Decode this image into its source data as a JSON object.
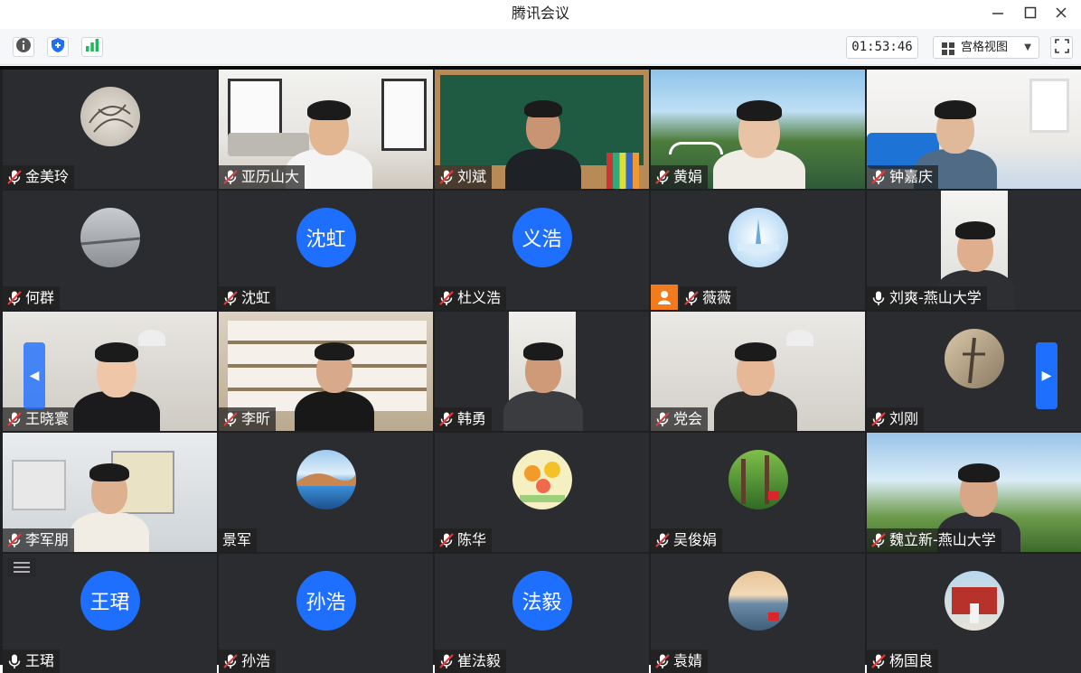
{
  "window": {
    "title": "腾讯会议",
    "minimize_icon": "minimize-icon",
    "maximize_icon": "maximize-icon",
    "close_icon": "close-icon"
  },
  "toolbar": {
    "info_icon": "info-icon",
    "security_icon": "shield-icon",
    "signal_icon": "signal-icon",
    "timer": "01:53:46",
    "view_label": "宫格视图",
    "fullscreen_icon": "fullscreen-icon"
  },
  "colors": {
    "accent": "#1f6fff",
    "tile_bg": "#2b2c30",
    "grid_bg": "#1f2024",
    "mic_muted": "#e23b3b"
  },
  "participants": [
    {
      "name": "金美玲",
      "muted": true
    },
    {
      "name": "亚历山大",
      "muted": true
    },
    {
      "name": "刘斌",
      "muted": true
    },
    {
      "name": "黄娟",
      "muted": true
    },
    {
      "name": "钟嘉庆",
      "muted": true
    },
    {
      "name": "何群",
      "muted": true
    },
    {
      "name": "沈虹",
      "muted": true,
      "avatar_text": "沈虹"
    },
    {
      "name": "杜义浩",
      "muted": true,
      "avatar_text": "义浩"
    },
    {
      "name": "薇薇",
      "muted": true,
      "host_badge": "person-icon"
    },
    {
      "name": "刘爽-燕山大学",
      "muted": false
    },
    {
      "name": "王晓寰",
      "muted": true
    },
    {
      "name": "李昕",
      "muted": true
    },
    {
      "name": "韩勇",
      "muted": true
    },
    {
      "name": "党会",
      "muted": true
    },
    {
      "name": "刘刚",
      "muted": true
    },
    {
      "name": "李军朋",
      "muted": true
    },
    {
      "name": "景军",
      "muted": false,
      "no_mic": true
    },
    {
      "name": "陈华",
      "muted": true
    },
    {
      "name": "吴俊娟",
      "muted": true
    },
    {
      "name": "魏立新-燕山大学",
      "muted": true
    },
    {
      "name": "王珺",
      "muted": false,
      "avatar_text": "王珺"
    },
    {
      "name": "孙浩",
      "muted": true,
      "avatar_text": "孙浩"
    },
    {
      "name": "崔法毅",
      "muted": true,
      "avatar_text": "法毅"
    },
    {
      "name": "袁婧",
      "muted": true
    },
    {
      "name": "杨国良",
      "muted": true
    }
  ],
  "nav": {
    "prev_icon": "chevron-left-icon",
    "next_icon": "chevron-right-icon",
    "menu_icon": "list-icon"
  }
}
